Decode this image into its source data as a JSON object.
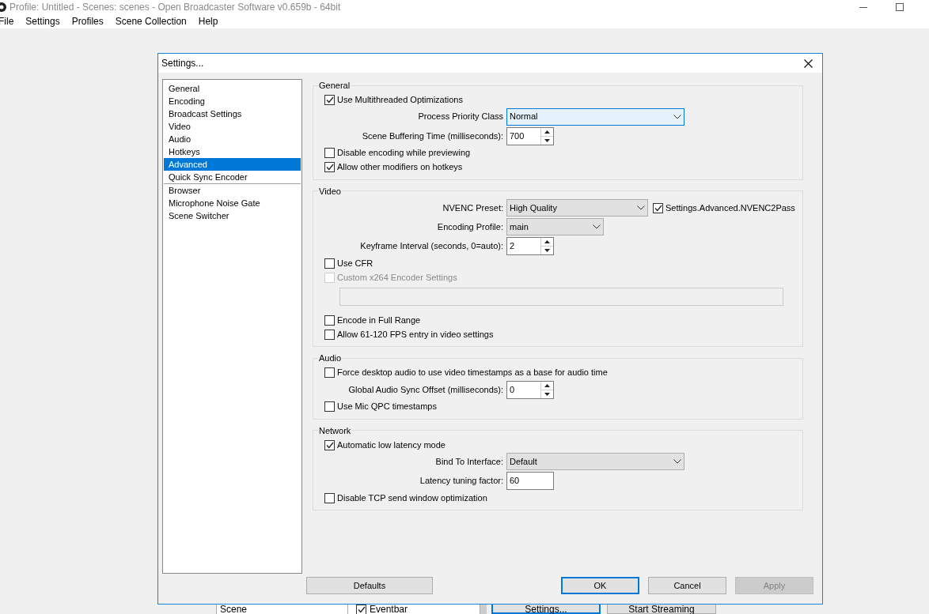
{
  "window": {
    "title": "Profile: Untitled - Scenes: scenes - Open Broadcaster Software v0.659b - 64bit"
  },
  "menu": [
    "File",
    "Settings",
    "Profiles",
    "Scene Collection",
    "Help"
  ],
  "background": {
    "scene_list_item": "Scene",
    "source_item": {
      "label": "Eventbar",
      "checked": true
    },
    "buttons": [
      "Settings...",
      "Start Streaming"
    ]
  },
  "dialog": {
    "title": "Settings...",
    "sidebar": {
      "sections": [
        {
          "items": [
            {
              "label": "General",
              "selected": false
            },
            {
              "label": "Encoding",
              "selected": false
            },
            {
              "label": "Broadcast Settings",
              "selected": false
            },
            {
              "label": "Video",
              "selected": false
            },
            {
              "label": "Audio",
              "selected": false
            },
            {
              "label": "Hotkeys",
              "selected": false
            },
            {
              "label": "Advanced",
              "selected": true
            },
            {
              "label": "Quick Sync Encoder",
              "selected": false
            }
          ]
        },
        {
          "items": [
            {
              "label": "Browser",
              "selected": false
            },
            {
              "label": "Microphone Noise Gate",
              "selected": false
            },
            {
              "label": "Scene Switcher",
              "selected": false
            }
          ]
        }
      ]
    },
    "groups": [
      {
        "title": "General",
        "rows": [
          {
            "kind": "checkbox",
            "label": "Use Multithreaded Optimizations",
            "checked": true
          },
          {
            "kind": "select",
            "label": "Process Priority Class",
            "value": "Normal",
            "focused": true
          },
          {
            "kind": "spin",
            "label": "Scene Buffering Time (milliseconds):",
            "value": "700"
          },
          {
            "kind": "checkbox",
            "label": "Disable encoding while previewing",
            "checked": false
          },
          {
            "kind": "checkbox",
            "label": "Allow other modifiers on hotkeys",
            "checked": true
          }
        ]
      },
      {
        "title": "Video",
        "rows": [
          {
            "kind": "select",
            "label": "NVENC Preset:",
            "value": "High Quality",
            "focused": false,
            "extra": {
              "label": "Settings.Advanced.NVENC2Pass",
              "checked": true
            }
          },
          {
            "kind": "select",
            "label": "Encoding Profile:",
            "value": "main",
            "focused": false
          },
          {
            "kind": "spin",
            "label": "Keyframe Interval (seconds, 0=auto):",
            "value": "2"
          },
          {
            "kind": "checkbox",
            "label": "Use CFR",
            "checked": false
          },
          {
            "kind": "checkbox",
            "label": "Custom x264 Encoder Settings",
            "checked": false,
            "disabled": true
          },
          {
            "kind": "blank_field",
            "disabled": true
          },
          {
            "kind": "checkbox",
            "label": "Encode in Full Range",
            "checked": false
          },
          {
            "kind": "checkbox",
            "label": "Allow 61-120 FPS entry in video settings",
            "checked": false
          }
        ]
      },
      {
        "title": "Audio",
        "rows": [
          {
            "kind": "checkbox",
            "label": "Force desktop audio to use video timestamps as a base for audio time",
            "checked": false
          },
          {
            "kind": "spin",
            "label": "Global Audio Sync Offset (milliseconds):",
            "value": "0"
          },
          {
            "kind": "checkbox",
            "label": "Use Mic QPC timestamps",
            "checked": false
          }
        ]
      },
      {
        "title": "Network",
        "rows": [
          {
            "kind": "checkbox",
            "label": "Automatic low latency mode",
            "checked": true
          },
          {
            "kind": "select",
            "label": "Bind To Interface:",
            "value": "Default",
            "focused": false
          },
          {
            "kind": "text",
            "label": "Latency tuning factor:",
            "value": "60"
          },
          {
            "kind": "checkbox",
            "label": "Disable TCP send window optimization",
            "checked": false
          }
        ]
      }
    ],
    "buttons": [
      {
        "label": "Defaults",
        "kind": "left",
        "default": false,
        "disabled": false
      },
      {
        "label": "OK",
        "kind": "right",
        "default": true,
        "disabled": false
      },
      {
        "label": "Cancel",
        "kind": "right",
        "default": false,
        "disabled": false
      },
      {
        "label": "Apply",
        "kind": "right",
        "default": false,
        "disabled": true
      }
    ]
  }
}
